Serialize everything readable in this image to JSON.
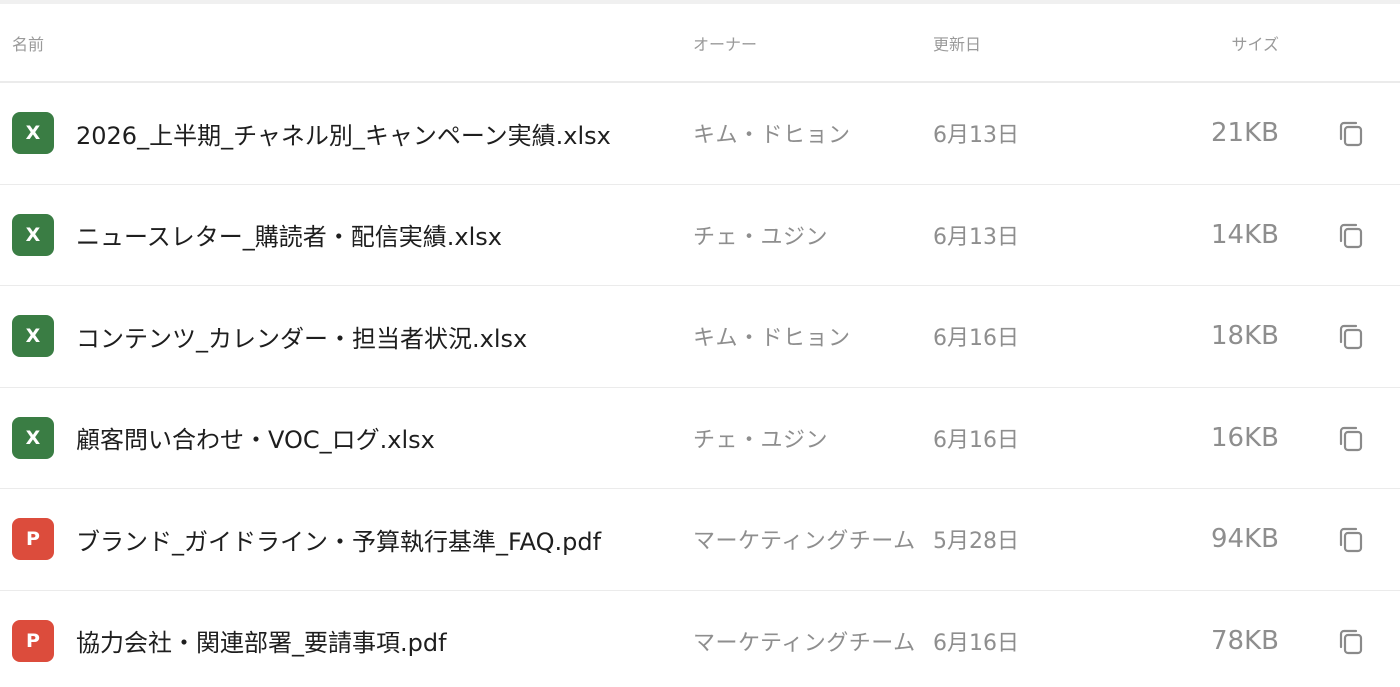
{
  "columns": {
    "name": "名前",
    "owner": "オーナー",
    "updated": "更新日",
    "size": "サイズ"
  },
  "icons": {
    "copy": "copy-icon"
  },
  "colors": {
    "xlsx_badge": "#3a7d44",
    "pdf_badge": "#dc4c3c"
  },
  "files": [
    {
      "badge": "X",
      "type": "xlsx",
      "name": "2026_上半期_チャネル別_キャンペーン実績.xlsx",
      "owner": "キム・ドヒョン",
      "updated": "6月13日",
      "size": "21KB"
    },
    {
      "badge": "X",
      "type": "xlsx",
      "name": "ニュースレター_購読者・配信実績.xlsx",
      "owner": "チェ・ユジン",
      "updated": "6月13日",
      "size": "14KB"
    },
    {
      "badge": "X",
      "type": "xlsx",
      "name": "コンテンツ_カレンダー・担当者状況.xlsx",
      "owner": "キム・ドヒョン",
      "updated": "6月16日",
      "size": "18KB"
    },
    {
      "badge": "X",
      "type": "xlsx",
      "name": "顧客問い合わせ・VOC_ログ.xlsx",
      "owner": "チェ・ユジン",
      "updated": "6月16日",
      "size": "16KB"
    },
    {
      "badge": "P",
      "type": "pdf",
      "name": "ブランド_ガイドライン・予算執行基準_FAQ.pdf",
      "owner": "マーケティングチーム",
      "updated": "5月28日",
      "size": "94KB"
    },
    {
      "badge": "P",
      "type": "pdf",
      "name": "協力会社・関連部署_要請事項.pdf",
      "owner": "マーケティングチーム",
      "updated": "6月16日",
      "size": "78KB"
    }
  ]
}
